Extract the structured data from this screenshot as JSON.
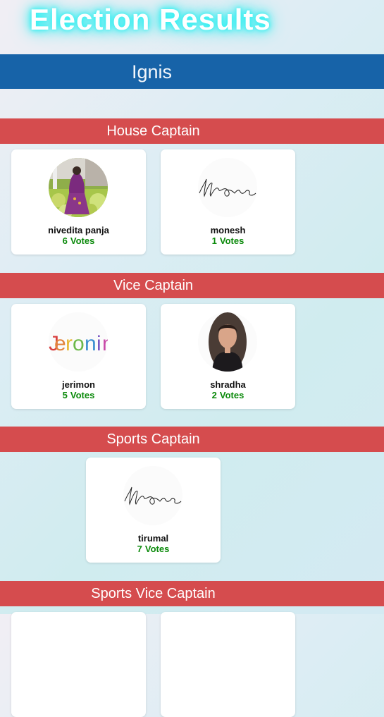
{
  "page": {
    "title": "Election Results"
  },
  "house": {
    "name": "Ignis"
  },
  "colors": {
    "house_bar": "#1763a8",
    "post_bar": "#d54c4e",
    "votes": "#0b8a0b",
    "title_glow": "#27f1f1"
  },
  "posts": [
    {
      "title": "House Captain",
      "candidates": [
        {
          "name": "nivedita panja",
          "votes": "6",
          "photo": "portrait-photo"
        },
        {
          "name": "monesh",
          "votes": "1",
          "photo": "signature-logo"
        }
      ]
    },
    {
      "title": "Vice Captain",
      "candidates": [
        {
          "name": "jerimon",
          "votes": "5",
          "photo": "colorful-name-logo"
        },
        {
          "name": "shradha",
          "votes": "2",
          "photo": "portrait-photo"
        }
      ]
    },
    {
      "title": "Sports Captain",
      "candidates": [
        {
          "name": "tirumal",
          "votes": "7",
          "photo": "signature-logo"
        }
      ]
    },
    {
      "title": "Sports Vice Captain",
      "candidates": []
    }
  ],
  "labels": {
    "votes_unit": "Votes"
  }
}
